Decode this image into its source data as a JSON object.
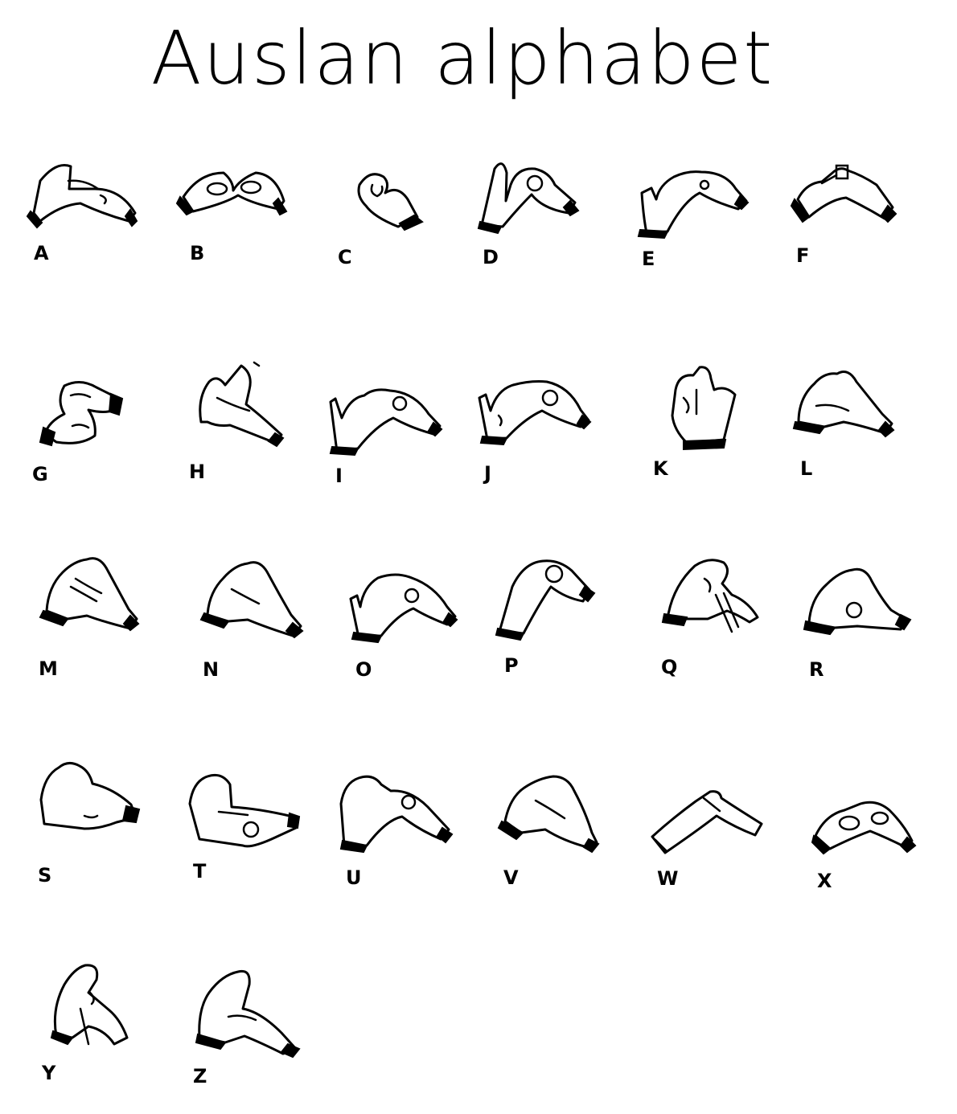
{
  "title": "Auslan alphabet",
  "signs": [
    {
      "letter": "A",
      "icon": "hand-sign-a-icon"
    },
    {
      "letter": "B",
      "icon": "hand-sign-b-icon"
    },
    {
      "letter": "C",
      "icon": "hand-sign-c-icon"
    },
    {
      "letter": "D",
      "icon": "hand-sign-d-icon"
    },
    {
      "letter": "E",
      "icon": "hand-sign-e-icon"
    },
    {
      "letter": "F",
      "icon": "hand-sign-f-icon"
    },
    {
      "letter": "G",
      "icon": "hand-sign-g-icon"
    },
    {
      "letter": "H",
      "icon": "hand-sign-h-icon"
    },
    {
      "letter": "I",
      "icon": "hand-sign-i-icon"
    },
    {
      "letter": "J",
      "icon": "hand-sign-j-icon"
    },
    {
      "letter": "K",
      "icon": "hand-sign-k-icon"
    },
    {
      "letter": "L",
      "icon": "hand-sign-l-icon"
    },
    {
      "letter": "M",
      "icon": "hand-sign-m-icon"
    },
    {
      "letter": "N",
      "icon": "hand-sign-n-icon"
    },
    {
      "letter": "O",
      "icon": "hand-sign-o-icon"
    },
    {
      "letter": "P",
      "icon": "hand-sign-p-icon"
    },
    {
      "letter": "Q",
      "icon": "hand-sign-q-icon"
    },
    {
      "letter": "R",
      "icon": "hand-sign-r-icon"
    },
    {
      "letter": "S",
      "icon": "hand-sign-s-icon"
    },
    {
      "letter": "T",
      "icon": "hand-sign-t-icon"
    },
    {
      "letter": "U",
      "icon": "hand-sign-u-icon"
    },
    {
      "letter": "V",
      "icon": "hand-sign-v-icon"
    },
    {
      "letter": "W",
      "icon": "hand-sign-w-icon"
    },
    {
      "letter": "X",
      "icon": "hand-sign-x-icon"
    },
    {
      "letter": "Y",
      "icon": "hand-sign-y-icon"
    },
    {
      "letter": "Z",
      "icon": "hand-sign-z-icon"
    }
  ]
}
